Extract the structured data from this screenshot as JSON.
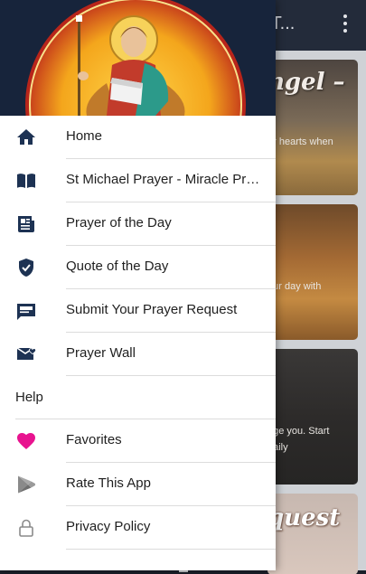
{
  "app_bar": {
    "title": "l T...",
    "more_icon": "more-vert-icon"
  },
  "cards": [
    {
      "heading": "ngel –",
      "text_lines": [
        "ur hearts when"
      ]
    },
    {
      "heading": "",
      "text_lines": [
        "our day with"
      ]
    },
    {
      "heading": "",
      "text_lines": [
        "age you. Start",
        "daily"
      ]
    },
    {
      "heading": "quest",
      "text_lines": []
    }
  ],
  "drawer": {
    "header_image": "st-michael-archangel-icon-image",
    "items": [
      {
        "label": "Home",
        "icon": "home-icon"
      },
      {
        "label": "St Michael Prayer - Miracle Prayer",
        "icon": "book-icon"
      },
      {
        "label": "Prayer of the Day",
        "icon": "newspaper-icon"
      },
      {
        "label": "Quote of the Day",
        "icon": "shield-check-icon"
      },
      {
        "label": "Submit Your Prayer Request",
        "icon": "message-box-icon"
      },
      {
        "label": "Prayer Wall",
        "icon": "email-heart-icon"
      }
    ],
    "section_label": "Help",
    "help_items": [
      {
        "label": "Favorites",
        "icon": "heart-icon"
      },
      {
        "label": "Rate This App",
        "icon": "play-store-icon"
      },
      {
        "label": "Privacy Policy",
        "icon": "lock-icon"
      }
    ]
  },
  "colors": {
    "app_bar": "#232b3a",
    "drawer_header": "#17243b",
    "icon_navy": "#1d3253",
    "favorite_pink": "#e8138f",
    "icon_gray": "#8a8a8a"
  }
}
